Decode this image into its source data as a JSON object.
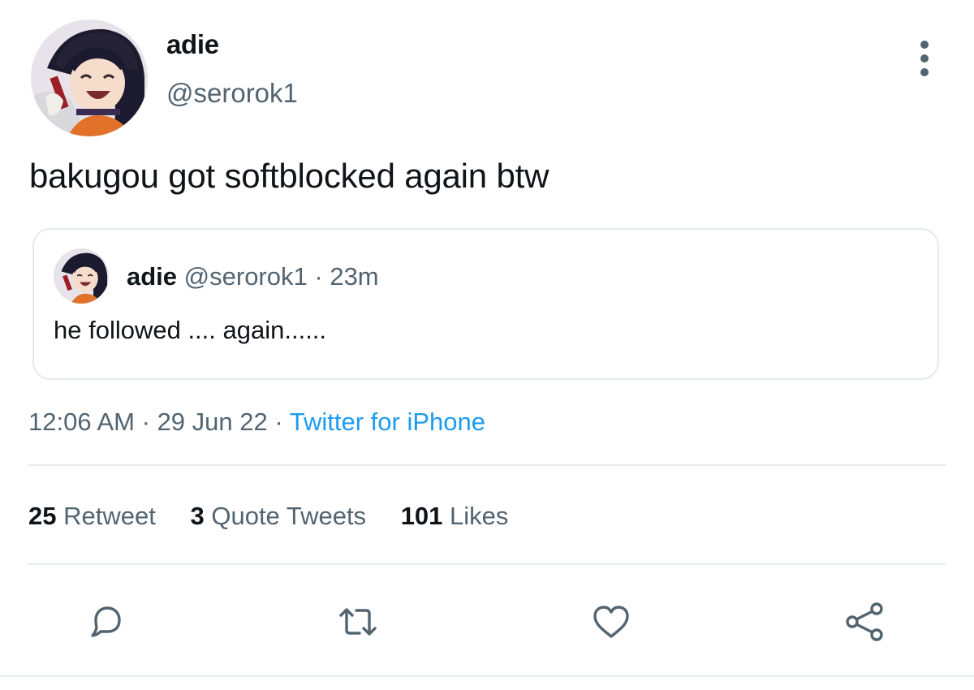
{
  "author": {
    "name": "adie",
    "handle": "@serorok1"
  },
  "tweet": {
    "text": "bakugou got softblocked again btw"
  },
  "quoted": {
    "name": "adie",
    "handle": "@serorok1",
    "separator": "·",
    "time": "23m",
    "text": "he followed .... again......"
  },
  "meta": {
    "time": "12:06 AM",
    "sep1": "·",
    "date": "29 Jun 22",
    "sep2": "·",
    "source": "Twitter for iPhone"
  },
  "stats": {
    "retweets": {
      "count": "25",
      "label": "Retweet"
    },
    "quotes": {
      "count": "3",
      "label": "Quote Tweets"
    },
    "likes": {
      "count": "101",
      "label": "Likes"
    }
  },
  "icons": {
    "more": "more-vertical-icon",
    "reply": "reply-icon",
    "retweet": "retweet-icon",
    "like": "heart-icon",
    "share": "share-icon"
  },
  "colors": {
    "text": "#0f1419",
    "secondary": "#536471",
    "link": "#1d9bf0",
    "border": "#e6e9ec"
  }
}
